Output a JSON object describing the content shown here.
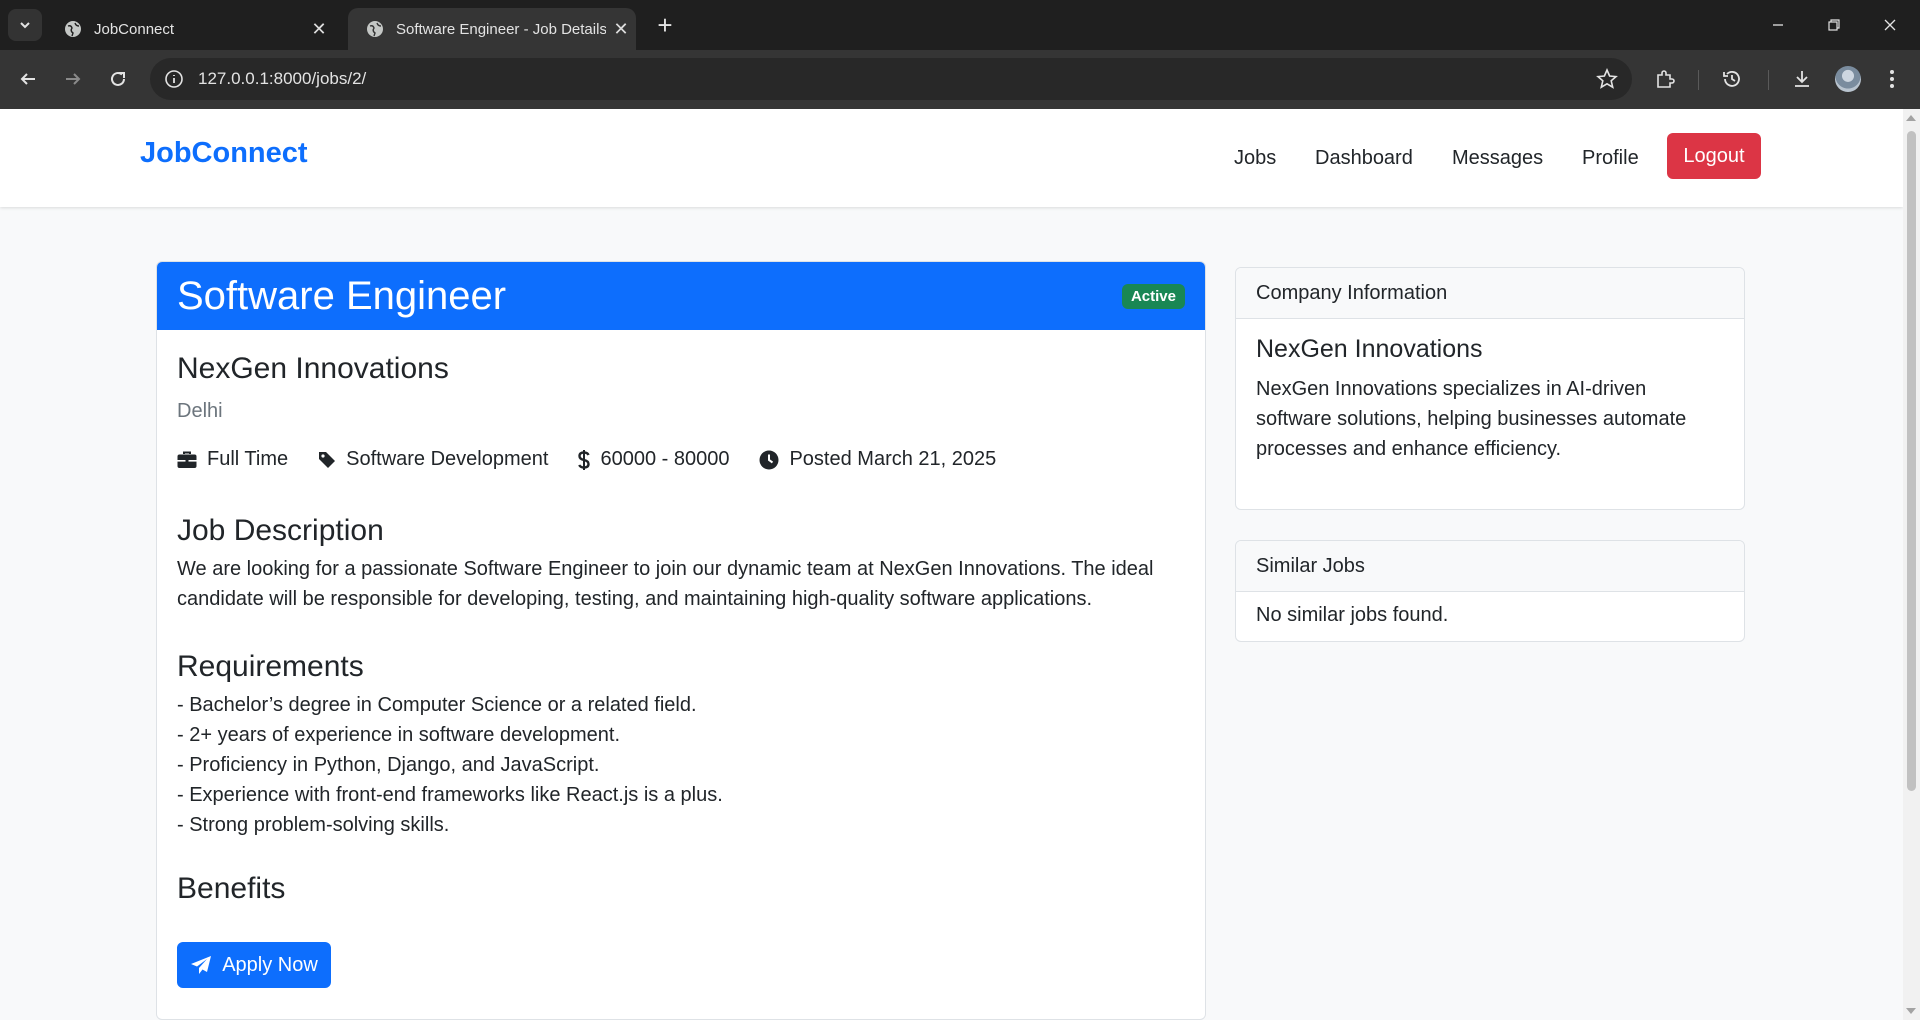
{
  "browser": {
    "tabs": [
      {
        "title": "JobConnect"
      },
      {
        "title": "Software Engineer - Job Details"
      }
    ],
    "url": "127.0.0.1:8000/jobs/2/"
  },
  "nav": {
    "brand": "JobConnect",
    "links": [
      "Jobs",
      "Dashboard",
      "Messages",
      "Profile"
    ],
    "logout": "Logout"
  },
  "job": {
    "title": "Software Engineer",
    "status": "Active",
    "company": "NexGen Innovations",
    "location": "Delhi",
    "type": "Full Time",
    "category": "Software Development",
    "salary": "60000 - 80000",
    "posted": "Posted March 21, 2025",
    "description_heading": "Job Description",
    "description": "We are looking for a passionate Software Engineer to join our dynamic team at NexGen Innovations. The ideal candidate will be responsible for developing, testing, and maintaining high-quality software applications.",
    "requirements_heading": "Requirements",
    "requirements": [
      "- Bachelor’s degree in Computer Science or a related field.",
      "- 2+ years of experience in software development.",
      "- Proficiency in Python, Django, and JavaScript.",
      "- Experience with front-end frameworks like React.js is a plus.",
      "- Strong problem-solving skills."
    ],
    "benefits_heading": "Benefits",
    "apply_label": "Apply Now"
  },
  "sidebar": {
    "company_card": {
      "header": "Company Information",
      "name": "NexGen Innovations",
      "description": "NexGen Innovations specializes in AI-driven software solutions, helping businesses automate processes and enhance efficiency."
    },
    "similar_card": {
      "header": "Similar Jobs",
      "empty_text": "No similar jobs found."
    }
  },
  "colors": {
    "primary": "#0d6efd",
    "danger": "#dc3545",
    "success": "#198754"
  }
}
